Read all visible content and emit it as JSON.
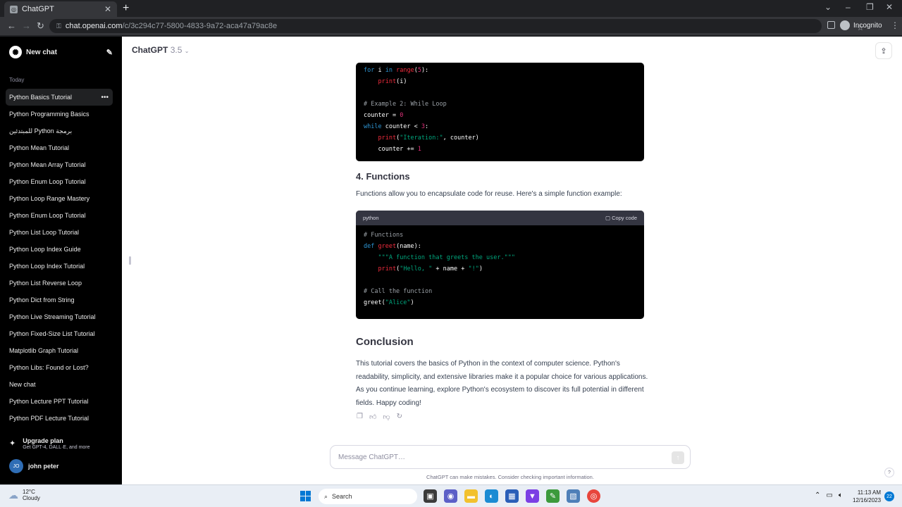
{
  "browser": {
    "tab_title": "ChatGPT",
    "tab_close": "✕",
    "new_tab": "+",
    "url_host": "chat.openai.com",
    "url_path": "/c/3c294c77-5800-4833-9a72-aca47a79ac8e",
    "incognito_label": "Incognito"
  },
  "sidebar": {
    "new_chat_label": "New chat",
    "section_label": "Today",
    "items": [
      {
        "label": "Python Basics Tutorial"
      },
      {
        "label": "Python Programming Basics"
      },
      {
        "label": "برمجة Python للمبتدئين"
      },
      {
        "label": "Python Mean Tutorial"
      },
      {
        "label": "Python Mean Array Tutorial"
      },
      {
        "label": "Python Enum Loop Tutorial"
      },
      {
        "label": "Python Loop Range Mastery"
      },
      {
        "label": "Python Enum Loop Tutorial"
      },
      {
        "label": "Python List Loop Tutorial"
      },
      {
        "label": "Python Loop Index Guide"
      },
      {
        "label": "Python Loop Index Tutorial"
      },
      {
        "label": "Python List Reverse Loop"
      },
      {
        "label": "Python Dict from String"
      },
      {
        "label": "Python Live Streaming Tutorial"
      },
      {
        "label": "Python Fixed-Size List Tutorial"
      },
      {
        "label": "Matplotlib Graph Tutorial"
      },
      {
        "label": "Python Libs: Found or Lost?"
      },
      {
        "label": "New chat"
      },
      {
        "label": "Python Lecture PPT Tutorial"
      },
      {
        "label": "Python PDF Lecture Tutorial"
      }
    ],
    "upgrade_title": "Upgrade plan",
    "upgrade_sub": "Get GPT-4, DALL·E, and more",
    "user_initials": "JO",
    "user_name": "john peter"
  },
  "header": {
    "model_name": "ChatGPT",
    "model_version": "3.5"
  },
  "content": {
    "section4_title": "4. Functions",
    "section4_text": "Functions allow you to encapsulate code for reuse. Here's a simple function example:",
    "code_lang": "python",
    "copy_label": "Copy code",
    "conclusion_title": "Conclusion",
    "conclusion_text": "This tutorial covers the basics of Python in the context of computer science. Python's readability, simplicity, and extensive libraries make it a popular choice for various applications. As you continue learning, explore Python's ecosystem to discover its full potential in different fields. Happy coding!"
  },
  "composer": {
    "placeholder": "Message ChatGPT…",
    "disclaimer": "ChatGPT can make mistakes. Consider checking important information."
  },
  "taskbar": {
    "temperature": "12°C",
    "condition": "Cloudy",
    "search_label": "Search",
    "time": "11:13 AM",
    "date": "12/16/2023",
    "notification_count": "22"
  }
}
